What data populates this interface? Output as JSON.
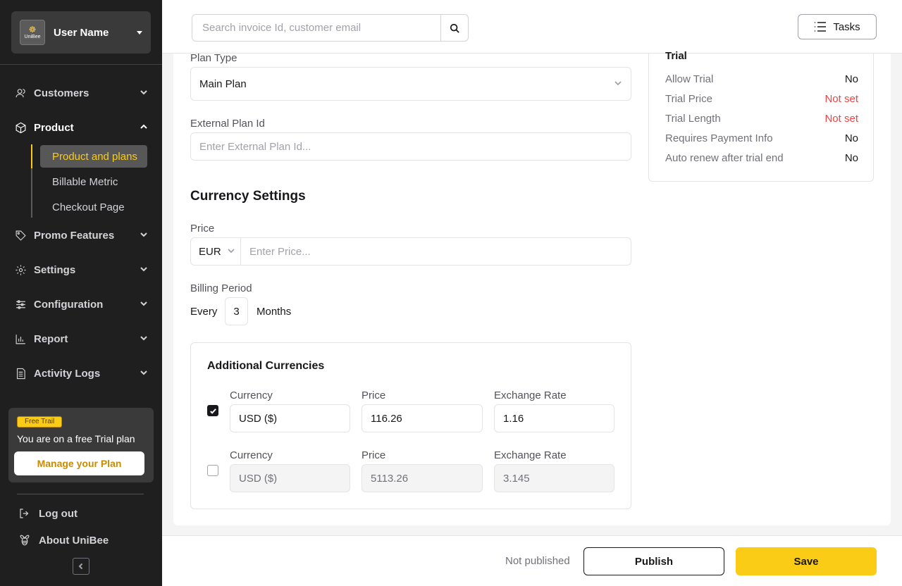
{
  "sidebar": {
    "user_name": "User Name",
    "logo_text": "UniBee",
    "nav": [
      {
        "label": "Customers",
        "icon": "users-icon"
      },
      {
        "label": "Product",
        "icon": "box-icon"
      },
      {
        "label": "Promo Features",
        "icon": "tag-icon"
      },
      {
        "label": "Settings",
        "icon": "gear-icon"
      },
      {
        "label": "Configuration",
        "icon": "sliders-icon"
      },
      {
        "label": "Report",
        "icon": "bar-chart-icon"
      },
      {
        "label": "Activity Logs",
        "icon": "file-list-icon"
      }
    ],
    "product_sub": [
      "Product and plans",
      "Billable Metric",
      "Checkout Page"
    ],
    "trial_badge": "Free Trail",
    "trial_text": "You are on a free Trial plan",
    "manage_plan": "Manage your Plan",
    "logout": "Log out",
    "about": "About UniBee",
    "accent_color": "#facc15"
  },
  "header": {
    "search_placeholder": "Search invoice Id, customer email",
    "tasks_label": "Tasks"
  },
  "form": {
    "plan_type_label": "Plan Type",
    "plan_type_value": "Main Plan",
    "external_id_label": "External Plan Id",
    "external_id_placeholder": "Enter External Plan Id...",
    "currency_settings_title": "Currency Settings",
    "price_label": "Price",
    "price_currency": "EUR",
    "price_placeholder": "Enter Price...",
    "billing_period_label": "Billing Period",
    "every_label": "Every",
    "period_count": "3",
    "period_unit": "Months"
  },
  "additional_currencies": {
    "title": "Additional Currencies",
    "rows": [
      {
        "checked": true,
        "currency_label": "Currency",
        "currency": "USD ($)",
        "price_label": "Price",
        "price": "116.26",
        "rate_label": "Exchange Rate",
        "rate": "1.16"
      },
      {
        "checked": false,
        "currency_label": "Currency",
        "currency": "USD ($)",
        "price_label": "Price",
        "price": "5113.26",
        "rate_label": "Exchange Rate",
        "rate": "3.145"
      }
    ]
  },
  "trial": {
    "title": "Trial",
    "rows": [
      {
        "key": "Allow Trial",
        "value": "No"
      },
      {
        "key": "Trial Price",
        "value": "Not set"
      },
      {
        "key": "Trial Length",
        "value": "Not set"
      },
      {
        "key": "Requires Payment Info",
        "value": "No"
      },
      {
        "key": "Auto renew after trial end",
        "value": "No"
      }
    ]
  },
  "footer": {
    "status": "Not published",
    "publish_label": "Publish",
    "save_label": "Save"
  }
}
